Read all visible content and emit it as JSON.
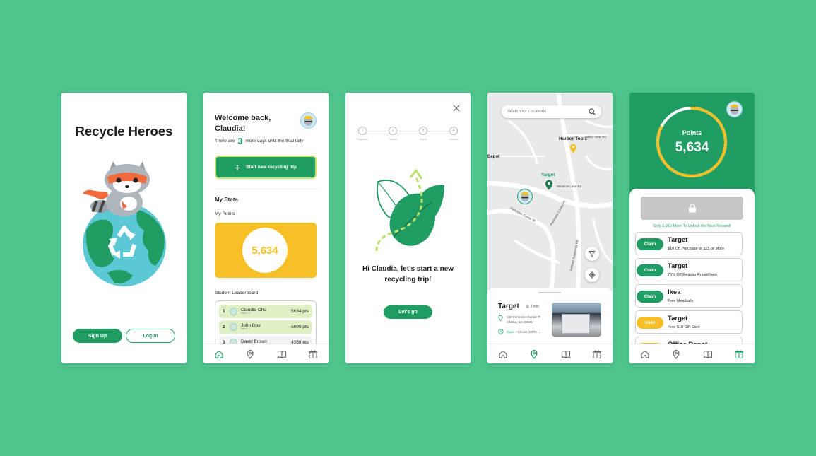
{
  "colors": {
    "background": "#4fc48d",
    "primary": "#1f9d63",
    "accent": "#f7bf26",
    "lightgreen": "#dff0c4"
  },
  "screen1": {
    "title": "Recycle Heroes",
    "signup": "Sign Up",
    "login": "Log In"
  },
  "screen2": {
    "welcome": "Welcome back, Claudia!",
    "days_pre": "There are",
    "days_num": "3",
    "days_post": "more days until the final tally!",
    "start_trip": "Start new recycling trip",
    "stats_heading": "My Stats",
    "points_label": "My Points",
    "points": "5,634",
    "leaderboard_heading": "Student Leaderboard",
    "leaderboard": [
      {
        "rank": "1",
        "name": "Claudia Chu",
        "sub": "Hero • 2",
        "pts": "5634 pts"
      },
      {
        "rank": "2",
        "name": "John Doe",
        "sub": "Hero • 1",
        "pts": "5609 pts"
      },
      {
        "rank": "3",
        "name": "David Brown",
        "sub": "",
        "pts": "4358 pts"
      }
    ]
  },
  "screen3": {
    "steps": [
      {
        "num": "1",
        "label": "Preparation"
      },
      {
        "num": "2",
        "label": "Location"
      },
      {
        "num": "3",
        "label": "Dropoff"
      },
      {
        "num": "4",
        "label": "Complete"
      }
    ],
    "prompt": "Hi Claudia, let's start a new recycling trip!",
    "go": "Let's go"
  },
  "screen4": {
    "search_placeholder": "Search for Locations",
    "map_labels": {
      "harbor": "Harbor Tools",
      "target": "Target",
      "depot": "Depot"
    },
    "streets": [
      "Meadow Lane Rd",
      "Perimeter Center W",
      "Perimeter Center Pl",
      "Ashford Dunwoody Rd",
      "Valley View Rd"
    ],
    "card": {
      "name": "Target",
      "eta": "3 min",
      "address1": "100 Perimeter Center Pl",
      "address2": "Atlanta, GA 30346",
      "status": "Open",
      "closes": "• Closes 10PM"
    }
  },
  "screen5": {
    "points_label": "Points",
    "points": "5,634",
    "points_progress": 0.82,
    "unlock_note": "Only 1,016 More To Unlock the Next Reward!",
    "rewards": [
      {
        "status": "Claim",
        "store": "Target",
        "desc": "$10 Off Purchase of $15 or More"
      },
      {
        "status": "Claim",
        "store": "Target",
        "desc": "75% Off Regular Priced Item"
      },
      {
        "status": "Claim",
        "store": "Ikea",
        "desc": "Free Meatballs"
      },
      {
        "status": "Used",
        "store": "Target",
        "desc": "Free $10 Gift Card"
      },
      {
        "status": "",
        "store": "Office Depot",
        "desc": ""
      }
    ]
  },
  "nav": {
    "icons": [
      "home-icon",
      "location-pin-icon",
      "book-icon",
      "gift-icon"
    ]
  }
}
